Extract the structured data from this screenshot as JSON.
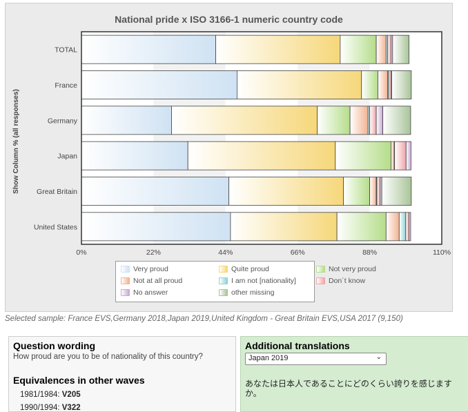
{
  "chart_data": {
    "type": "bar",
    "orientation": "horizontal",
    "stacked": true,
    "title": "National pride x ISO 3166-1 numeric country code",
    "ylabel": "Show Column % (all responses)",
    "xlabel": "",
    "x_ticks": [
      "0%",
      "22%",
      "44%",
      "66%",
      "88%",
      "110%"
    ],
    "xlim": [
      0,
      110
    ],
    "categories": [
      "TOTAL",
      "France",
      "Germany",
      "Japan",
      "Great Britain",
      "United States"
    ],
    "series": [
      {
        "name": "Very proud",
        "color": "#cfe2f3",
        "values": [
          41,
          47.5,
          27.5,
          32.5,
          45,
          45.5
        ]
      },
      {
        "name": "Quite proud",
        "color": "#f6d77a",
        "values": [
          38,
          38,
          44.5,
          45,
          35,
          32.5
        ]
      },
      {
        "name": "Not very proud",
        "color": "#b5dd8a",
        "values": [
          11,
          5,
          10,
          17,
          8,
          15
        ]
      },
      {
        "name": "Not at all proud",
        "color": "#f2b391",
        "values": [
          3,
          3,
          5.5,
          1,
          2,
          4
        ]
      },
      {
        "name": "I am not [nationality]",
        "color": "#8fd3d6",
        "values": [
          0.5,
          0.3,
          0.5,
          0.1,
          0.2,
          2
        ]
      },
      {
        "name": "Don´t know",
        "color": "#f0a5a8",
        "values": [
          1,
          0.7,
          2,
          3.5,
          1,
          1
        ]
      },
      {
        "name": "No answer",
        "color": "#c9a8d6",
        "values": [
          0.5,
          0.2,
          2,
          1.5,
          0.5,
          0.5
        ]
      },
      {
        "name": "other missing",
        "color": "#a9c49a",
        "values": [
          5,
          6,
          8.5,
          0,
          9,
          0
        ]
      }
    ],
    "legend_position": "bottom",
    "grid": true
  },
  "caption": "Selected sample: France EVS,Germany 2018,Japan 2019,United Kingdom - Great Britain EVS,USA 2017 (9,150)",
  "question": {
    "title": "Question wording",
    "text": "How proud are you to be of nationality of this country?",
    "equiv_title": "Equivalences in other waves",
    "waves": [
      {
        "label": "1981/1984:",
        "code": "V205"
      },
      {
        "label": "1990/1994:",
        "code": "V322"
      }
    ]
  },
  "translations": {
    "title": "Additional translations",
    "selected": "Japan 2019",
    "text": "あなたは日本人であることにどのくらい誇りを感じますか。"
  }
}
